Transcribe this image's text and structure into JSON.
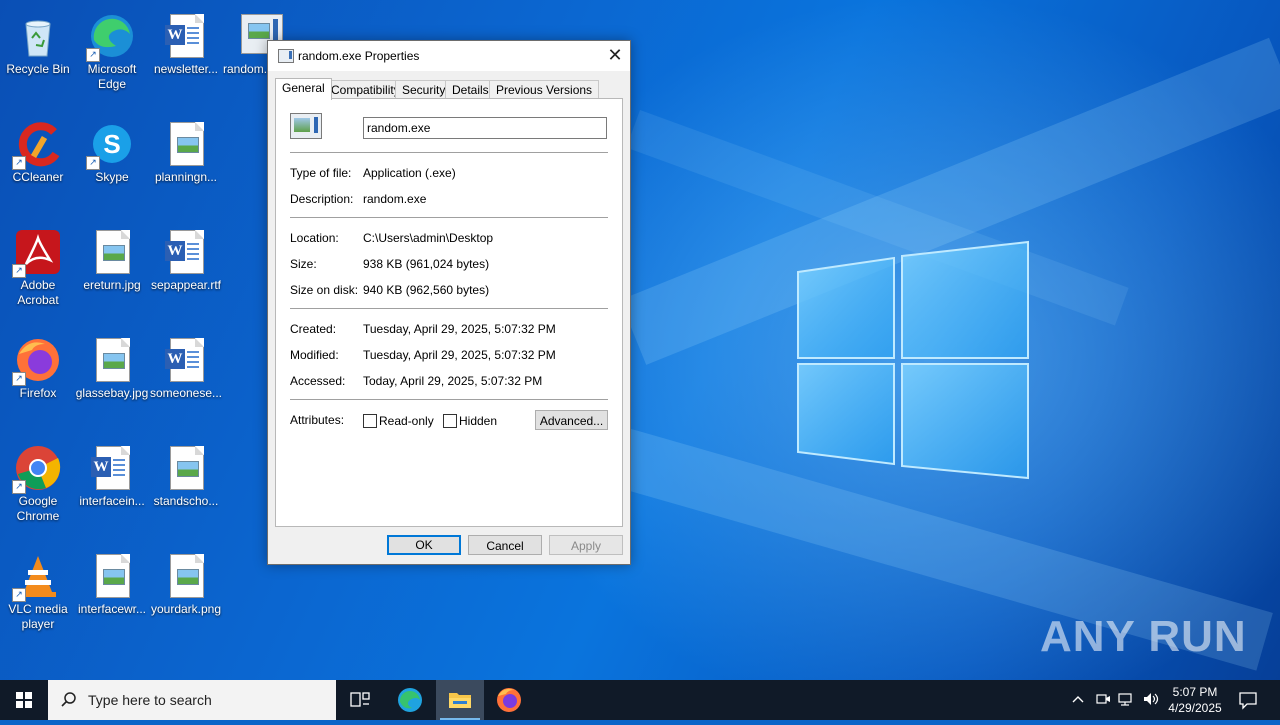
{
  "desktop": {
    "icons": [
      {
        "label": "Recycle Bin",
        "type": "recycle"
      },
      {
        "label": "Microsoft Edge",
        "type": "edge"
      },
      {
        "label": "newsletter...",
        "type": "word"
      },
      {
        "label": "random.exe",
        "type": "exe"
      },
      {
        "label": "CCleaner",
        "type": "ccleaner"
      },
      {
        "label": "Skype",
        "type": "skype"
      },
      {
        "label": "planningn...",
        "type": "image"
      },
      {
        "label": "Adobe Acrobat",
        "type": "acrobat"
      },
      {
        "label": "ereturn.jpg",
        "type": "image"
      },
      {
        "label": "sepappear.rtf",
        "type": "word"
      },
      {
        "label": "Firefox",
        "type": "firefox"
      },
      {
        "label": "glassebay.jpg",
        "type": "image"
      },
      {
        "label": "someonese...",
        "type": "word"
      },
      {
        "label": "Google Chrome",
        "type": "chrome"
      },
      {
        "label": "interfacein...",
        "type": "word"
      },
      {
        "label": "standscho...",
        "type": "image"
      },
      {
        "label": "VLC media player",
        "type": "vlc"
      },
      {
        "label": "interfacewr...",
        "type": "image"
      },
      {
        "label": "yourdark.png",
        "type": "image"
      }
    ]
  },
  "dialog": {
    "title": "random.exe Properties",
    "close_glyph": "✕",
    "tabs": [
      "General",
      "Compatibility",
      "Security",
      "Details",
      "Previous Versions"
    ],
    "active_tab": "General",
    "filename": "random.exe",
    "fields": {
      "type_label": "Type of file:",
      "type_value": "Application (.exe)",
      "desc_label": "Description:",
      "desc_value": "random.exe",
      "loc_label": "Location:",
      "loc_value": "C:\\Users\\admin\\Desktop",
      "size_label": "Size:",
      "size_value": "938 KB (961,024 bytes)",
      "sod_label": "Size on disk:",
      "sod_value": "940 KB (962,560 bytes)",
      "created_label": "Created:",
      "created_value": "Tuesday, April 29, 2025, 5:07:32 PM",
      "modified_label": "Modified:",
      "modified_value": "Tuesday, April 29, 2025, 5:07:32 PM",
      "accessed_label": "Accessed:",
      "accessed_value": "Today, April 29, 2025, 5:07:32 PM",
      "attr_label": "Attributes:",
      "readonly_label": "Read-only",
      "hidden_label": "Hidden",
      "advanced_label": "Advanced..."
    },
    "buttons": {
      "ok": "OK",
      "cancel": "Cancel",
      "apply": "Apply"
    }
  },
  "taskbar": {
    "search_placeholder": "Type here to search",
    "time": "5:07 PM",
    "date": "4/29/2025"
  },
  "watermark": "ANY RUN",
  "colors": {
    "accent": "#0078d7",
    "taskbar": "#101a28",
    "desktop": "#0a64c8"
  }
}
